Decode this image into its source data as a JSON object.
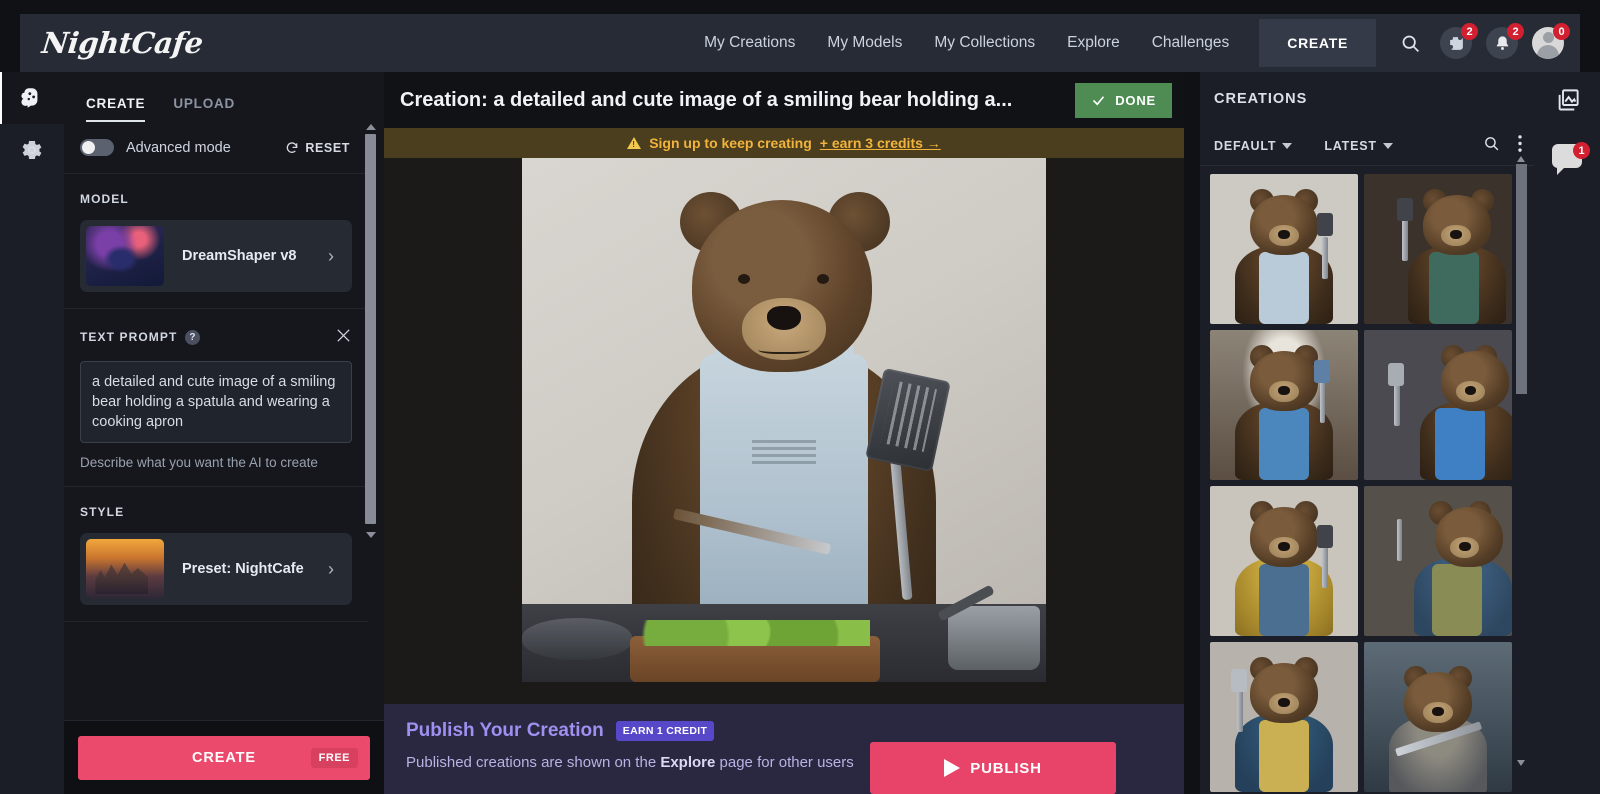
{
  "app": {
    "logo": "NightCafe"
  },
  "topbar": {
    "nav": [
      {
        "label": "My Creations"
      },
      {
        "label": "My Models"
      },
      {
        "label": "My Collections"
      },
      {
        "label": "Explore"
      },
      {
        "label": "Challenges"
      }
    ],
    "create_label": "CREATE",
    "search_icon": "search-icon",
    "dice_icon": "dice-icon",
    "dice_badge": "2",
    "bell_icon": "bell-icon",
    "bell_badge": "2",
    "avatar_icon": "avatar",
    "avatar_badge": "0"
  },
  "left_rail": {
    "items": [
      {
        "icon": "brain-icon",
        "active": true
      },
      {
        "icon": "gear-icon",
        "active": false
      }
    ]
  },
  "left_panel": {
    "tabs": [
      {
        "label": "CREATE",
        "active": true
      },
      {
        "label": "UPLOAD",
        "active": false
      }
    ],
    "advanced_mode_label": "Advanced mode",
    "advanced_mode_on": false,
    "reset_label": "RESET",
    "model": {
      "section_label": "MODEL",
      "name": "DreamShaper v8"
    },
    "prompt": {
      "section_label": "TEXT PROMPT",
      "help_glyph": "?",
      "value": "a detailed and cute image of a smiling bear holding a spatula and wearing a cooking apron",
      "placeholder": "Describe what you want the AI to create",
      "helper_text": "Describe what you want the AI to create"
    },
    "style": {
      "section_label": "STYLE",
      "name": "Preset: NightCafe"
    },
    "create_button": {
      "label": "CREATE",
      "badge": "FREE"
    }
  },
  "center": {
    "title": "Creation: a detailed and cute image of a smiling bear holding a...",
    "done_label": "DONE",
    "signup_banner": {
      "text": "Sign up to keep creating",
      "link": "+ earn 3 credits →"
    },
    "image_alt": "a detailed and cute image of a smiling bear holding a spatula and wearing a cooking apron"
  },
  "publish": {
    "title": "Publish Your Creation",
    "badge": "EARN 1 CREDIT",
    "subtitle_before": "Published creations are shown on the ",
    "subtitle_bold": "Explore",
    "subtitle_after": " page for other users",
    "button_label": "PUBLISH"
  },
  "right_panel": {
    "title": "CREATIONS",
    "filter_default": "DEFAULT",
    "filter_sort": "LATEST",
    "search_icon": "search-icon",
    "more_icon": "more-vertical-icon",
    "thumbnails": [
      {
        "name": "bear-with-spatula-grey-bg",
        "bg": "#cdc9c3",
        "apron": "#b9cbd8",
        "variant": 1
      },
      {
        "name": "bear-in-dark-kitchen",
        "bg": "#3b332b",
        "apron": "#3f6b5e",
        "variant": 2
      },
      {
        "name": "bear-by-window",
        "bg": "#6d6055",
        "apron": "#4b86bd",
        "variant": 3
      },
      {
        "name": "bear-with-fork-sandwich",
        "bg": "#4a4a50",
        "apron": "#3f7fc4",
        "variant": 4
      },
      {
        "name": "bear-yellow-shirt-blue-apron",
        "bg": "#c9c4bc",
        "apron": "#4a6f91",
        "variant": 5
      },
      {
        "name": "bear-blue-shirt-olive-apron",
        "bg": "#55514a",
        "apron": "#8a8c55",
        "variant": 6
      },
      {
        "name": "bear-yellow-apron-kitchen",
        "bg": "#b7b2ab",
        "apron": "#cbb053",
        "variant": 7
      },
      {
        "name": "bear-armored-warrior",
        "bg": "#46525c",
        "apron": "#7a7f85",
        "variant": 8
      }
    ]
  },
  "right_rail": {
    "items": [
      {
        "icon": "gallery-icon",
        "badge": null
      },
      {
        "icon": "chat-icon",
        "badge": "1"
      }
    ]
  },
  "colors": {
    "accent_pink": "#ec4a6d",
    "done_green": "#4e8c53",
    "warning_amber": "#f2b33c",
    "publish_purple": "#2a2740",
    "badge_red": "#d32030"
  }
}
